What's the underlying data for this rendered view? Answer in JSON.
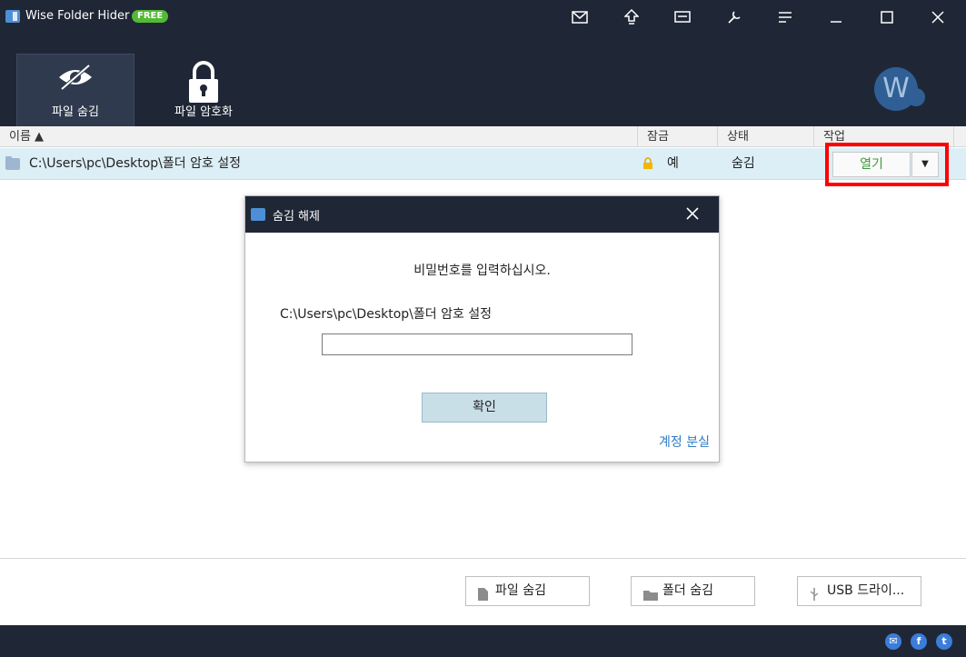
{
  "app": {
    "title": "Wise Folder Hider",
    "badge": "FREE",
    "accent_color": "#53b934",
    "bar_color": "#1f2736"
  },
  "titlebar_icons": [
    "mail-icon",
    "upload-icon",
    "message-icon",
    "tools-icon",
    "menu-icon",
    "minimize-icon",
    "maximize-icon",
    "close-icon"
  ],
  "tabs": [
    {
      "label": "파일 숨김",
      "icon": "eye-hidden-icon",
      "active": true
    },
    {
      "label": "파일 암호화",
      "icon": "lock-icon",
      "active": false
    }
  ],
  "avatar": {
    "letter": "W"
  },
  "table": {
    "columns": [
      "이름 ▲",
      "잠금",
      "상태",
      "작업"
    ],
    "rows": [
      {
        "name": "C:\\Users\\pc\\Desktop\\폴더 암호 설정",
        "lock": "예",
        "status": "숨김",
        "action": "열기",
        "action_dropdown": "▼"
      }
    ]
  },
  "dialog": {
    "title": "숨김 해제",
    "message": "비밀번호를 입력하십시오.",
    "path": "C:\\Users\\pc\\Desktop\\폴더 암호 설정",
    "password_value": "",
    "ok_label": "확인",
    "link_label": "계정 분실"
  },
  "bottom_buttons": [
    {
      "label": "파일 숨김",
      "icon": "file-icon"
    },
    {
      "label": "폴더 숨김",
      "icon": "folder-icon"
    },
    {
      "label": "USB 드라이...",
      "icon": "usb-icon"
    }
  ],
  "footer_icons": [
    {
      "name": "email-icon",
      "glyph": "✉"
    },
    {
      "name": "facebook-icon",
      "glyph": "f"
    },
    {
      "name": "twitter-icon",
      "glyph": "t"
    }
  ]
}
